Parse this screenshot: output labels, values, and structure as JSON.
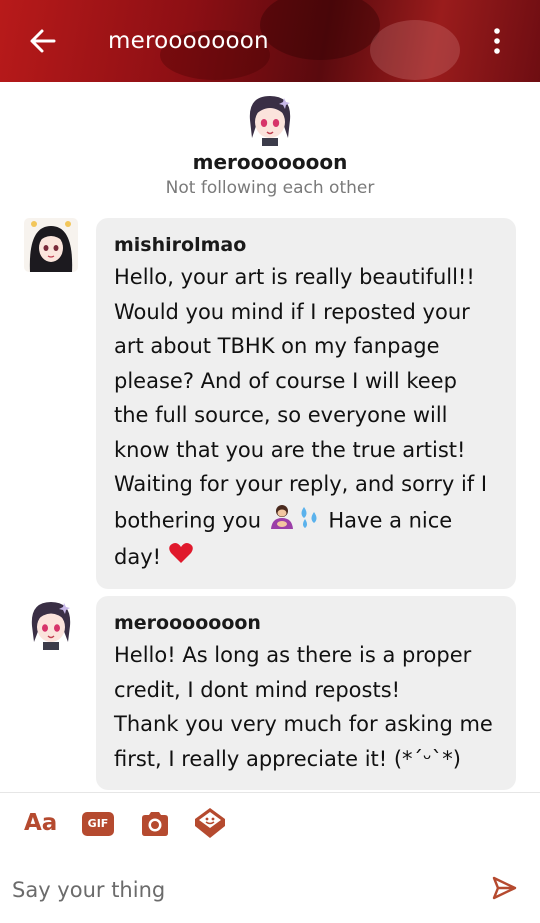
{
  "header": {
    "title": "merooooooon",
    "back_icon": "arrow-left-icon",
    "more_icon": "more-vertical-icon"
  },
  "profile": {
    "name": "merooooooon",
    "status": "Not following each other"
  },
  "messages": [
    {
      "author": "mishirolmao",
      "text": "Hello, your art is really beautifull!! Would you mind if I reposted your art about TBHK on my fanpage please? And of course I will keep the full source, so everyone will know that you are the true artist! Waiting for your reply, and sorry if I bothering you",
      "emojis": [
        "person-bowing-emoji",
        "sweat-droplets-emoji"
      ],
      "text_after": "Have a nice day!",
      "trailing_emoji": "red-heart-emoji"
    },
    {
      "author": "merooooooon",
      "text": "Hello! As long as there is a proper credit, I dont mind reposts!\nThank you very much for asking me first, I really appreciate it! (*´ᵕ`*)"
    }
  ],
  "toolbar": {
    "text_style_label": "Aa",
    "gif_label": "GIF",
    "camera_icon": "camera-icon",
    "sticker_icon": "sticker-icon"
  },
  "composer": {
    "placeholder": "Say your thing",
    "send_icon": "send-icon"
  },
  "colors": {
    "accent": "#b54a2f",
    "bubble": "#efefef",
    "header": "#8c0f14"
  }
}
